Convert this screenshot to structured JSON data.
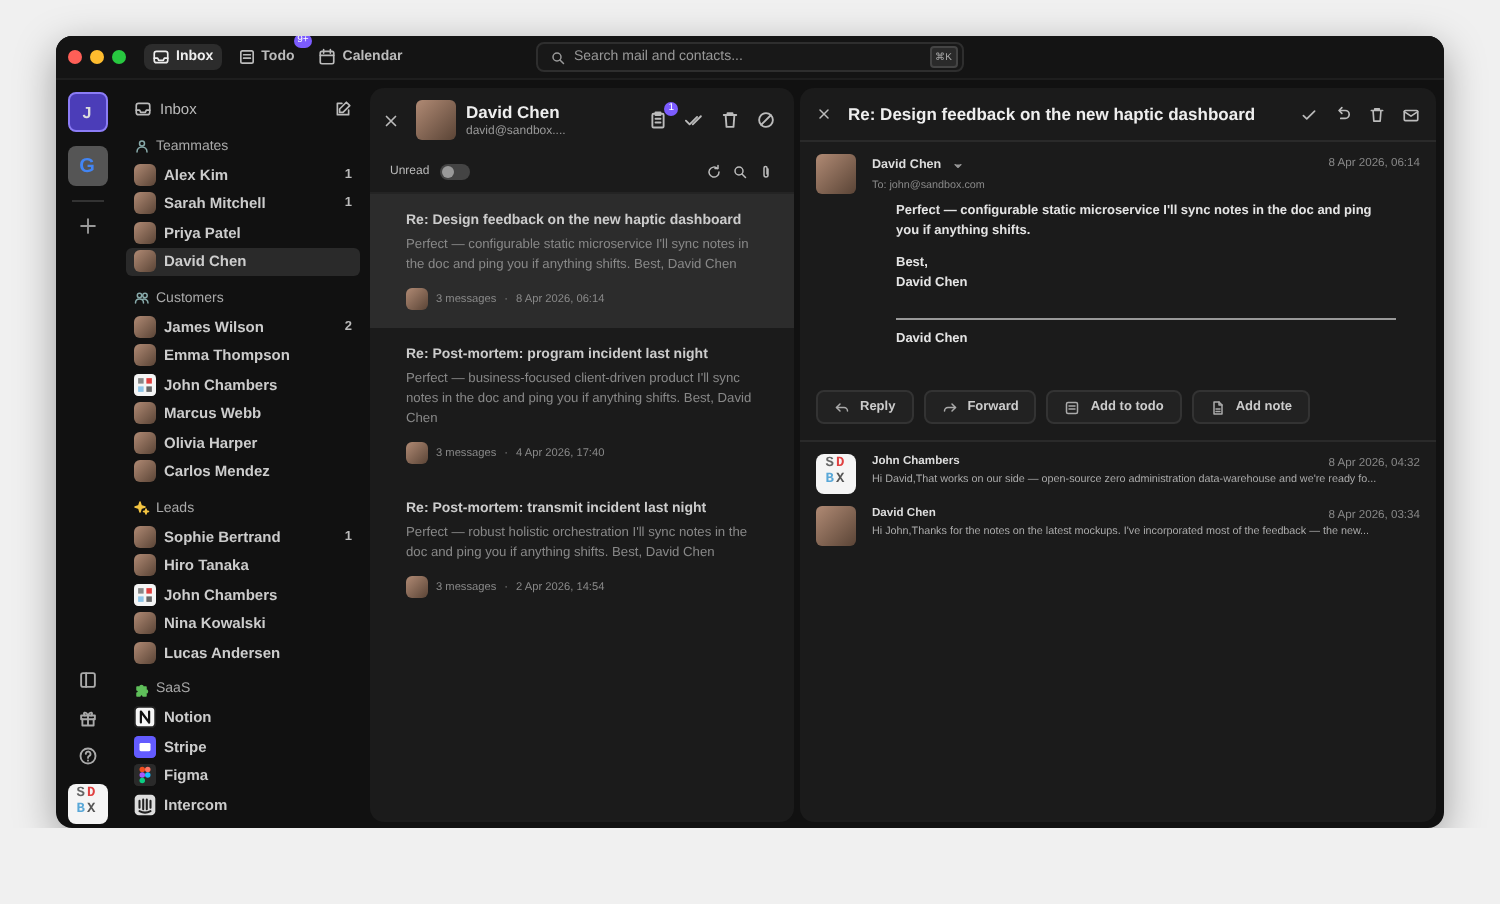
{
  "window": {
    "tabs": [
      {
        "label": "Inbox",
        "selected": true
      },
      {
        "label": "Todo",
        "selected": false,
        "badge": "9+"
      },
      {
        "label": "Calendar",
        "selected": false
      }
    ],
    "search": {
      "placeholder": "Search mail and contacts...",
      "shortcut": "⌘K"
    }
  },
  "accounts": [
    {
      "letter": "J",
      "kind": "initial",
      "selected": true
    },
    {
      "letter": "G",
      "kind": "google",
      "selected": false
    }
  ],
  "rail_logo": [
    "SD",
    "BX"
  ],
  "sidebar": {
    "inbox": "Inbox",
    "groups": [
      {
        "name": "Teammates",
        "items": [
          {
            "name": "Alex Kim",
            "kind": "photo",
            "count": "1",
            "selected": false
          },
          {
            "name": "Sarah Mitchell",
            "kind": "photo",
            "count": "1",
            "selected": false
          },
          {
            "name": "Priya Patel",
            "kind": "photo",
            "selected": false
          },
          {
            "name": "David Chen",
            "kind": "photo",
            "selected": true
          }
        ]
      },
      {
        "name": "Customers",
        "items": [
          {
            "name": "James Wilson",
            "kind": "photo",
            "count": "2",
            "selected": false
          },
          {
            "name": "Emma Thompson",
            "kind": "photo",
            "selected": false
          },
          {
            "name": "John Chambers",
            "kind": "logo",
            "selected": false
          },
          {
            "name": "Marcus Webb",
            "kind": "photo",
            "selected": false
          },
          {
            "name": "Olivia Harper",
            "kind": "photo",
            "selected": false
          },
          {
            "name": "Carlos Mendez",
            "kind": "photo",
            "selected": false
          }
        ]
      },
      {
        "name": "Leads",
        "items": [
          {
            "name": "Sophie Bertrand",
            "kind": "photo",
            "count": "1",
            "selected": false
          },
          {
            "name": "Hiro Tanaka",
            "kind": "photo",
            "selected": false
          },
          {
            "name": "John Chambers",
            "kind": "logo",
            "selected": false
          },
          {
            "name": "Nina Kowalski",
            "kind": "photo",
            "selected": false
          },
          {
            "name": "Lucas Andersen",
            "kind": "photo",
            "selected": false
          }
        ]
      },
      {
        "name": "SaaS",
        "items": [
          {
            "name": "Notion",
            "kind": "notion",
            "selected": false
          },
          {
            "name": "Stripe",
            "kind": "stripe",
            "selected": false
          },
          {
            "name": "Figma",
            "kind": "figma",
            "selected": false
          },
          {
            "name": "Intercom",
            "kind": "intercom",
            "selected": false
          }
        ]
      }
    ]
  },
  "thread_list": {
    "contact": {
      "name": "David Chen",
      "email": "david@sandbox....",
      "badge": "1"
    },
    "filter": {
      "label": "Unread",
      "on": false
    },
    "threads": [
      {
        "subject": "Re: Design feedback on the new haptic dashboard",
        "preview": "Perfect — configurable static microservice I'll sync notes in the doc and ping you if anything shifts. Best, David Chen",
        "count": "3 messages",
        "separator": "·",
        "date": "8 Apr 2026, 06:14",
        "selected": true
      },
      {
        "subject": "Re: Post-mortem: program incident last night",
        "preview": "Perfect — business-focused client-driven product I'll sync notes in the doc and ping you if anything shifts. Best, David Chen",
        "count": "3 messages",
        "separator": "·",
        "date": "4 Apr 2026, 17:40",
        "selected": false
      },
      {
        "subject": "Re: Post-mortem: transmit incident last night",
        "preview": "Perfect — robust holistic orchestration I'll sync notes in the doc and ping you if anything shifts. Best, David Chen",
        "count": "3 messages",
        "separator": "·",
        "date": "2 Apr 2026, 14:54",
        "selected": false
      }
    ]
  },
  "message": {
    "subject": "Re: Design feedback on the new haptic dashboard",
    "from": "David Chen",
    "to": "To: john@sandbox.com",
    "date": "8 Apr 2026, 06:14",
    "body": "Perfect — configurable static microservice I'll sync notes in the doc and ping you if anything shifts.",
    "closing": [
      "Best,",
      "David Chen"
    ],
    "signature": "David Chen",
    "actions": [
      "Reply",
      "Forward",
      "Add to todo",
      "Add note"
    ],
    "replies": [
      {
        "from": "John Chambers",
        "kind": "logo",
        "avatar_text": [
          "SD",
          "BX"
        ],
        "preview": "Hi David,That works on our side — open-source zero administration data-warehouse and we're ready fo...",
        "date": "8 Apr 2026, 04:32"
      },
      {
        "from": "David Chen",
        "kind": "photo",
        "preview": "Hi John,Thanks for the notes on the latest mockups. I've incorporated most of the feedback — the new...",
        "date": "8 Apr 2026, 03:34"
      }
    ]
  }
}
